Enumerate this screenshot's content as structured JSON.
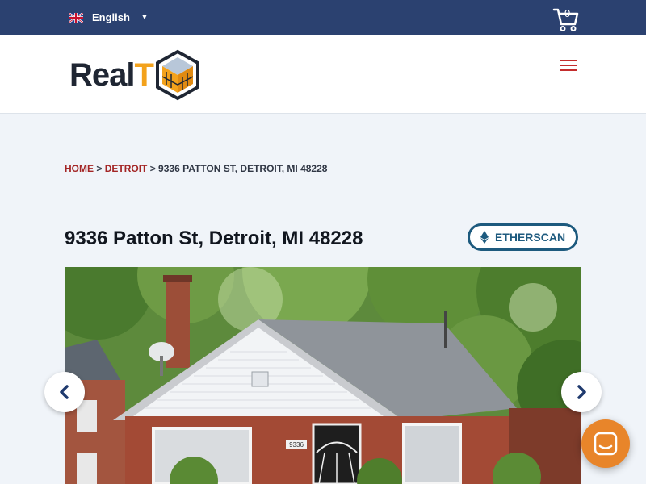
{
  "topbar": {
    "language": "English",
    "cart_count": "0"
  },
  "header": {
    "logo_text_main": "Real",
    "logo_text_accent": "T"
  },
  "breadcrumb": {
    "home": "HOME",
    "sep1": " > ",
    "city": "DETROIT",
    "sep2": " > ",
    "current": "9336 PATTON ST, DETROIT, MI 48228"
  },
  "property": {
    "title": "9336 Patton St, Detroit, MI 48228",
    "etherscan_label": "ETHERSCAN",
    "house_number": "9336"
  },
  "colors": {
    "topbar": "#2b4170",
    "brand_orange": "#f3a21c",
    "link_red": "#a32525",
    "etherscan_blue": "#1d5a7e",
    "chat_orange": "#e8852a"
  },
  "icons": [
    "uk-flag-icon",
    "caret-down-icon",
    "cart-icon",
    "hamburger-icon",
    "ethereum-icon",
    "chevron-left-icon",
    "chevron-right-icon",
    "chat-icon"
  ]
}
